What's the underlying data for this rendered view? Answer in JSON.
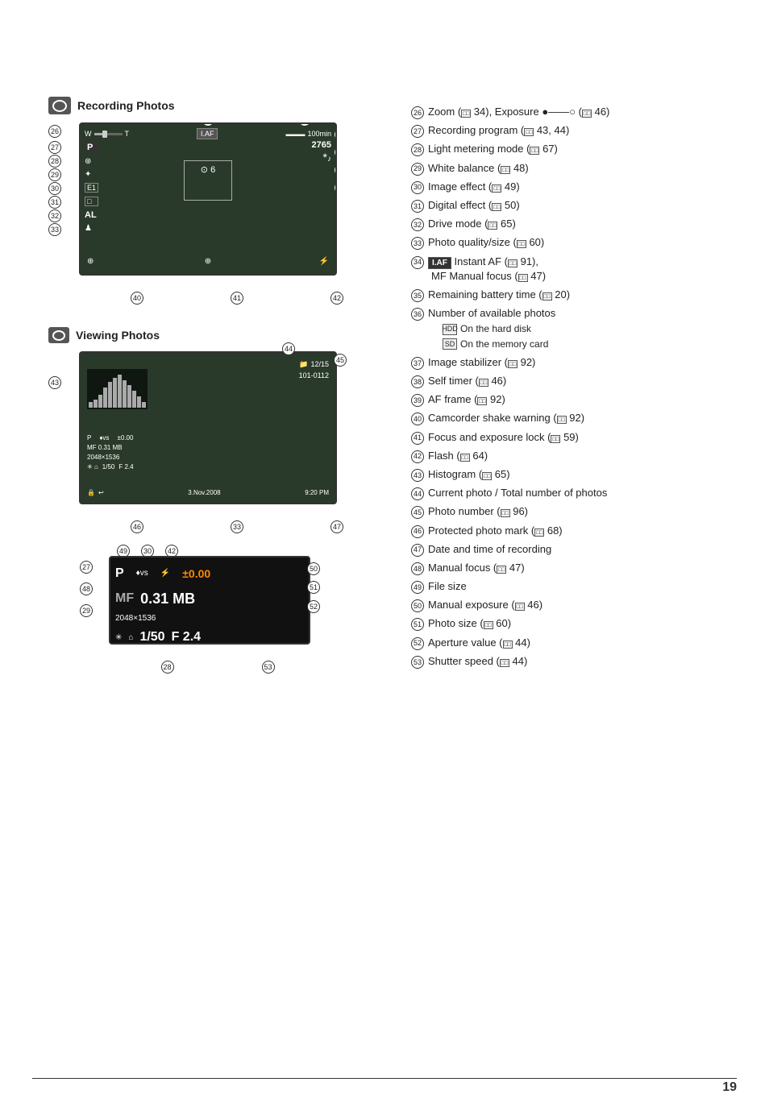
{
  "page": {
    "number": "19"
  },
  "sections": {
    "recording_photos": {
      "title": "Recording Photos",
      "screen_elements": {
        "zoom_w": "W",
        "zoom_t": "T",
        "iaf": "I.AF",
        "battery": "100min",
        "photo_count": "2765",
        "bell_symbol": "♪",
        "p_mode": "P",
        "self_timer": "⊙ 6",
        "focus_icon": "⊕",
        "al_mode": "AL",
        "person_icon": "♟"
      }
    },
    "viewing_photos": {
      "title": "Viewing Photos",
      "screen_elements": {
        "photo_count": "12/15",
        "folder": "101-0112",
        "p_mode": "P",
        "mf_value": "MF 0.31 MB",
        "resolution": "2048×1536",
        "exposure": "±0.00",
        "shutter": "1/50",
        "aperture": "F 2.4",
        "date": "3.Nov.2008",
        "time": "9:20 PM",
        "hist_heights": [
          10,
          15,
          25,
          35,
          40,
          38,
          32,
          25,
          18,
          12,
          8,
          5
        ]
      }
    },
    "detail": {
      "screen_elements": {
        "p_mode": "P",
        "wb_icon": "♦vs",
        "exposure": "±0.00",
        "mf": "MF",
        "value": "0.31 MB",
        "resolution": "2048×1536",
        "star_icon": "✳",
        "bracket_icon": "⌂",
        "shutter": "1/50",
        "aperture": "F 2.4"
      }
    }
  },
  "items": [
    {
      "num": "26",
      "text": "Zoom (",
      "book": "34",
      "extra": "), Exposure",
      "suffix": "(",
      "book2": "46",
      "suffix2": ")"
    },
    {
      "num": "27",
      "text": "Recording program (",
      "book": "43, 44",
      "suffix": ")"
    },
    {
      "num": "28",
      "text": "Light metering mode (",
      "book": "67",
      "suffix": ")"
    },
    {
      "num": "29",
      "text": "White balance (",
      "book": "48",
      "suffix": ")"
    },
    {
      "num": "30",
      "text": "Image effect (",
      "book": "49",
      "suffix": ")"
    },
    {
      "num": "31",
      "text": "Digital effect (",
      "book": "50",
      "suffix": ")"
    },
    {
      "num": "32",
      "text": "Drive mode (",
      "book": "65",
      "suffix": ")"
    },
    {
      "num": "33",
      "text": "Photo quality/size (",
      "book": "60",
      "suffix": ")"
    },
    {
      "num": "34",
      "text": "Instant AF (",
      "book": "91",
      "suffix": "),",
      "line2": "MF Manual focus (",
      "book2": "47",
      "suffix2": ")",
      "iaf": true
    },
    {
      "num": "35",
      "text": "Remaining battery time (",
      "book": "20",
      "suffix": ")"
    },
    {
      "num": "36",
      "text": "Number of available photos",
      "sub1": "On the hard disk",
      "sub2": "On the memory card"
    },
    {
      "num": "37",
      "text": "Image stabilizer (",
      "book": "92",
      "suffix": ")"
    },
    {
      "num": "38",
      "text": "Self timer (",
      "book": "46",
      "suffix": ")"
    },
    {
      "num": "39",
      "text": "AF frame (",
      "book": "92",
      "suffix": ")"
    },
    {
      "num": "40",
      "text": "Camcorder shake warning (",
      "book": "92",
      "suffix": ")"
    },
    {
      "num": "41",
      "text": "Focus and exposure lock (",
      "book": "59",
      "suffix": ")"
    },
    {
      "num": "42",
      "text": "Flash (",
      "book": "64",
      "suffix": ")"
    },
    {
      "num": "43",
      "text": "Histogram (",
      "book": "65",
      "suffix": ")"
    },
    {
      "num": "44",
      "text": "Current photo / Total number of photos"
    },
    {
      "num": "45",
      "text": "Photo number (",
      "book": "96",
      "suffix": ")"
    },
    {
      "num": "46",
      "text": "Protected photo mark (",
      "book": "68",
      "suffix": ")"
    },
    {
      "num": "47",
      "text": "Date and time of recording"
    },
    {
      "num": "48",
      "text": "Manual focus (",
      "book": "47",
      "suffix": ")"
    },
    {
      "num": "49",
      "text": "File size"
    },
    {
      "num": "50",
      "text": "Manual exposure (",
      "book": "46",
      "suffix": ")"
    },
    {
      "num": "51",
      "text": "Photo size (",
      "book": "60",
      "suffix": ")"
    },
    {
      "num": "52",
      "text": "Aperture value (",
      "book": "44",
      "suffix": ")"
    },
    {
      "num": "53",
      "text": "Shutter speed (",
      "book": "44",
      "suffix": ")"
    }
  ],
  "labels": {
    "recording_photos": "Recording Photos",
    "viewing_photos": "Viewing Photos"
  }
}
